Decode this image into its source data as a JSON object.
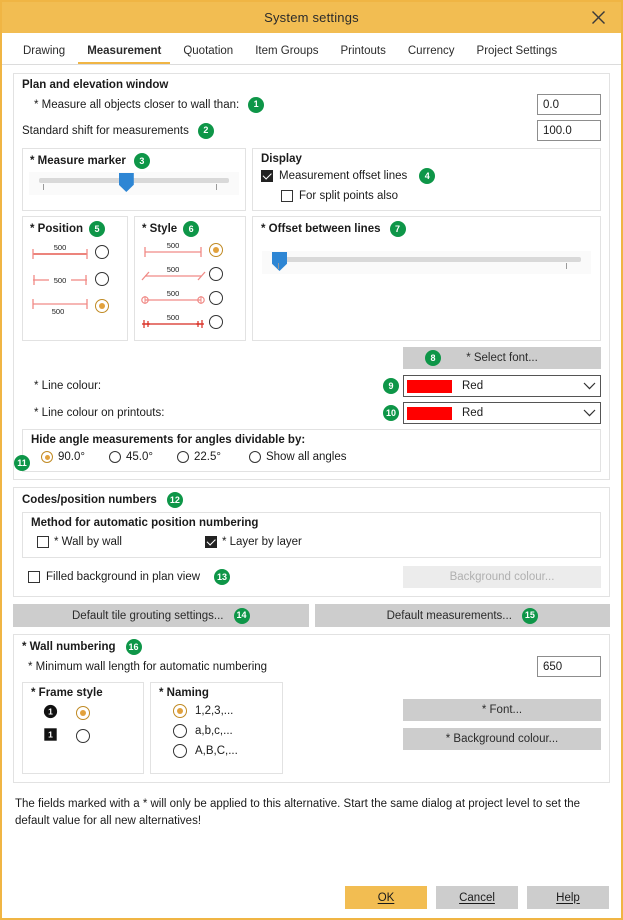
{
  "window": {
    "title": "System settings",
    "close_icon": "close-icon"
  },
  "tabs": [
    {
      "label": "Drawing",
      "active": false
    },
    {
      "label": "Measurement",
      "active": true
    },
    {
      "label": "Quotation",
      "active": false
    },
    {
      "label": "Item Groups",
      "active": false
    },
    {
      "label": "Printouts",
      "active": false
    },
    {
      "label": "Currency",
      "active": false
    },
    {
      "label": "Project Settings",
      "active": false
    }
  ],
  "plan_group": {
    "title": "Plan and elevation window",
    "measure_closer_label": "* Measure all objects closer to wall than:",
    "measure_closer_badge": "1",
    "measure_closer_value": "0.0",
    "standard_shift_label": "Standard shift for measurements",
    "standard_shift_badge": "2",
    "standard_shift_value": "100.0"
  },
  "measure_marker": {
    "title": "* Measure marker",
    "badge": "3",
    "value_percent": 44
  },
  "display": {
    "title": "Display",
    "offset_lines_label": "Measurement offset lines",
    "offset_lines_badge": "4",
    "offset_lines_checked": true,
    "split_points_label": "For split points also",
    "split_points_checked": false
  },
  "position": {
    "title": "* Position",
    "badge": "5",
    "options": [
      {
        "value": "500",
        "selected": false,
        "variant": "above"
      },
      {
        "value": "500",
        "selected": false,
        "variant": "inline"
      },
      {
        "value": "500",
        "selected": true,
        "variant": "below"
      }
    ]
  },
  "style": {
    "title": "* Style",
    "badge": "6",
    "options": [
      {
        "value": "500",
        "selected": true,
        "variant": "plus"
      },
      {
        "value": "500",
        "selected": false,
        "variant": "slash"
      },
      {
        "value": "500",
        "selected": false,
        "variant": "circle"
      },
      {
        "value": "500",
        "selected": false,
        "variant": "arrow"
      }
    ]
  },
  "offset_between_lines": {
    "title": "* Offset between lines",
    "badge": "7",
    "value_percent": 1
  },
  "select_font": {
    "label": "* Select font...",
    "badge": "8"
  },
  "line_colour": {
    "label": "* Line colour:",
    "badge": "9",
    "value": "Red",
    "swatch_hex": "#FF0000"
  },
  "line_colour_printouts": {
    "label": "* Line colour on printouts:",
    "badge": "10",
    "value": "Red",
    "swatch_hex": "#FF0000"
  },
  "hide_angles": {
    "title": "Hide angle measurements for angles dividable by:",
    "badge": "11",
    "options": [
      {
        "label": "90.0°",
        "selected": true
      },
      {
        "label": "45.0°",
        "selected": false
      },
      {
        "label": "22.5°",
        "selected": false
      },
      {
        "label": "Show all angles",
        "selected": false
      }
    ]
  },
  "codes": {
    "title": "Codes/position numbers",
    "badge": "12",
    "method_title": "Method for automatic position numbering",
    "wall_by_wall_label": "* Wall by wall",
    "wall_by_wall_checked": false,
    "layer_by_layer_label": "* Layer by layer",
    "layer_by_layer_checked": true,
    "filled_bg_label": "Filled background in plan view",
    "filled_bg_badge": "13",
    "filled_bg_checked": false,
    "background_colour_btn": "Background colour..."
  },
  "default_buttons": {
    "tile_grouting": "Default tile grouting settings...",
    "tile_grouting_badge": "14",
    "measurements": "Default measurements...",
    "measurements_badge": "15"
  },
  "wall_numbering": {
    "title": "* Wall numbering",
    "badge": "16",
    "min_length_label": "* Minimum wall length for automatic numbering",
    "min_length_value": "650",
    "frame_style_title": "* Frame style",
    "frame_options": [
      {
        "shape": "circle",
        "glyph": "1",
        "selected": true
      },
      {
        "shape": "square",
        "glyph": "1",
        "selected": false
      }
    ],
    "naming_title": "* Naming",
    "naming_options": [
      {
        "label": "1,2,3,...",
        "selected": true
      },
      {
        "label": "a,b,c,...",
        "selected": false
      },
      {
        "label": "A,B,C,...",
        "selected": false
      }
    ],
    "font_btn": "* Font...",
    "background_colour_btn": "* Background colour..."
  },
  "footnote": "The fields marked with a * will only be applied to this alternative. Start the same dialog at project level to set the default value for all new alternatives!",
  "footer": {
    "ok": "OK",
    "cancel": "Cancel",
    "help": "Help"
  },
  "colors": {
    "accent": "#f2bd52",
    "badge_green": "#0e9648",
    "slider_blue": "#2e86d4",
    "radio_amber": "#e2a13c",
    "measure_red": "#e03a2f",
    "measure_pink": "#f08a86"
  }
}
